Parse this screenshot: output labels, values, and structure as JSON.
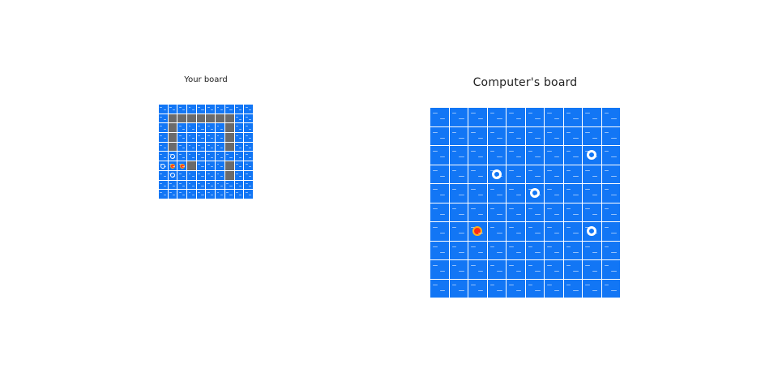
{
  "player_board": {
    "title": "Your board",
    "rows": 10,
    "cols": 10,
    "ship_cells": [
      [
        1,
        1
      ],
      [
        1,
        2
      ],
      [
        1,
        3
      ],
      [
        1,
        4
      ],
      [
        1,
        5
      ],
      [
        1,
        6
      ],
      [
        1,
        7
      ],
      [
        2,
        7
      ],
      [
        3,
        7
      ],
      [
        4,
        7
      ],
      [
        2,
        1
      ],
      [
        3,
        1
      ],
      [
        4,
        1
      ],
      [
        6,
        3
      ],
      [
        6,
        7
      ],
      [
        7,
        7
      ]
    ],
    "hit_cells": [
      [
        6,
        1
      ],
      [
        6,
        2
      ]
    ],
    "miss_cells": [
      [
        5,
        1
      ],
      [
        6,
        0
      ],
      [
        7,
        1
      ]
    ]
  },
  "computer_board": {
    "title": "Computer's board",
    "rows": 10,
    "cols": 10,
    "hit_cells": [
      [
        6,
        2
      ]
    ],
    "miss_cells": [
      [
        2,
        8
      ],
      [
        3,
        3
      ],
      [
        4,
        5
      ],
      [
        6,
        8
      ]
    ]
  },
  "colors": {
    "water": "#1276f5",
    "ship": "#6b6b6b",
    "hit": "#ff2a14",
    "miss": "#ffffff"
  }
}
